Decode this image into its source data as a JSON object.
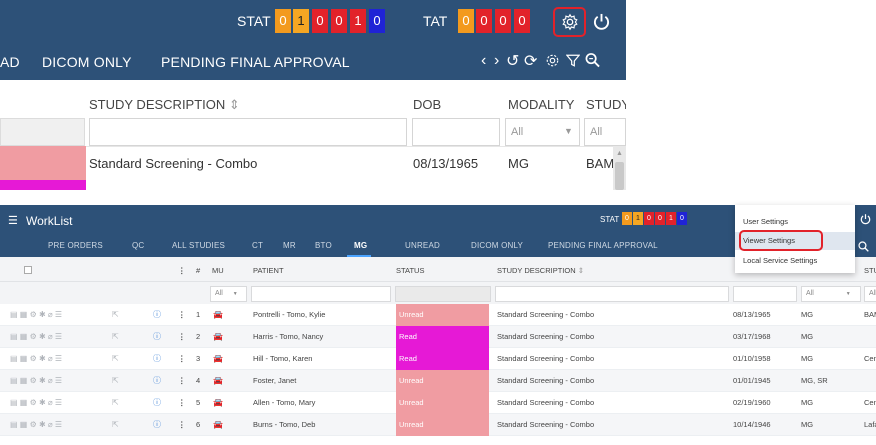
{
  "top": {
    "stat_label": "STAT",
    "stat_counts": [
      "0",
      "1",
      "0",
      "0",
      "1",
      "0"
    ],
    "tat_label": "TAT",
    "tat_counts": [
      "0",
      "0",
      "0",
      "0"
    ],
    "nav": [
      "AD",
      "DICOM ONLY",
      "PENDING FINAL APPROVAL"
    ],
    "columns": [
      "STUDY DESCRIPTION",
      "DOB",
      "MODALITY",
      "STUDY"
    ],
    "modality_filter": "All",
    "study_filter": "All",
    "row": {
      "description": "Standard Screening - Combo",
      "dob": "08/13/1965",
      "modality": "MG",
      "study": "BAM/"
    }
  },
  "worklist": {
    "title": "WorkList",
    "stat_label": "STAT",
    "stat_counts": [
      "0",
      "1",
      "0",
      "0",
      "1",
      "0"
    ],
    "tabs": [
      "PRE ORDERS",
      "QC",
      "ALL STUDIES",
      "CT",
      "MR",
      "BTO",
      "MG",
      "UNREAD",
      "DICOM ONLY",
      "PENDING FINAL APPROVAL"
    ],
    "active_tab": "MG",
    "columns": {
      "hash": "#",
      "mu": "MU",
      "patient": "PATIENT",
      "status": "STATUS",
      "description": "STUDY DESCRIPTION",
      "modality": "",
      "study": "STU"
    },
    "filter_all": "All",
    "rows": [
      {
        "num": "1",
        "patient": "Pontrelli - Tomo, Kylie",
        "status": "Unread",
        "description": "Standard Screening - Combo",
        "dob": "08/13/1965",
        "modality": "MG",
        "study": "BAM"
      },
      {
        "num": "2",
        "patient": "Harris - Tomo, Nancy",
        "status": "Read",
        "description": "Standard Screening - Combo",
        "dob": "03/17/1968",
        "modality": "MG",
        "study": ""
      },
      {
        "num": "3",
        "patient": "Hill - Tomo, Karen",
        "status": "Read",
        "description": "Standard Screening - Combo",
        "dob": "01/10/1958",
        "modality": "MG",
        "study": "Cent"
      },
      {
        "num": "4",
        "patient": "Foster, Janet",
        "status": "Unread",
        "description": "Standard Screening - Combo",
        "dob": "01/01/1945",
        "modality": "MG, SR",
        "study": ""
      },
      {
        "num": "5",
        "patient": "Allen - Tomo, Mary",
        "status": "Unread",
        "description": "Standard Screening - Combo",
        "dob": "02/19/1960",
        "modality": "MG",
        "study": "Cent"
      },
      {
        "num": "6",
        "patient": "Burns - Tomo, Deb",
        "status": "Unread",
        "description": "Standard Screening - Combo",
        "dob": "10/14/1946",
        "modality": "MG",
        "study": "Lafa"
      }
    ],
    "settings_menu": [
      "User Settings",
      "Viewer Settings",
      "Local Service Settings"
    ]
  },
  "colors": {
    "header": "#2d5178",
    "unread": "#f09ca2",
    "read": "#e619d6",
    "highlight": "#e2222a"
  }
}
